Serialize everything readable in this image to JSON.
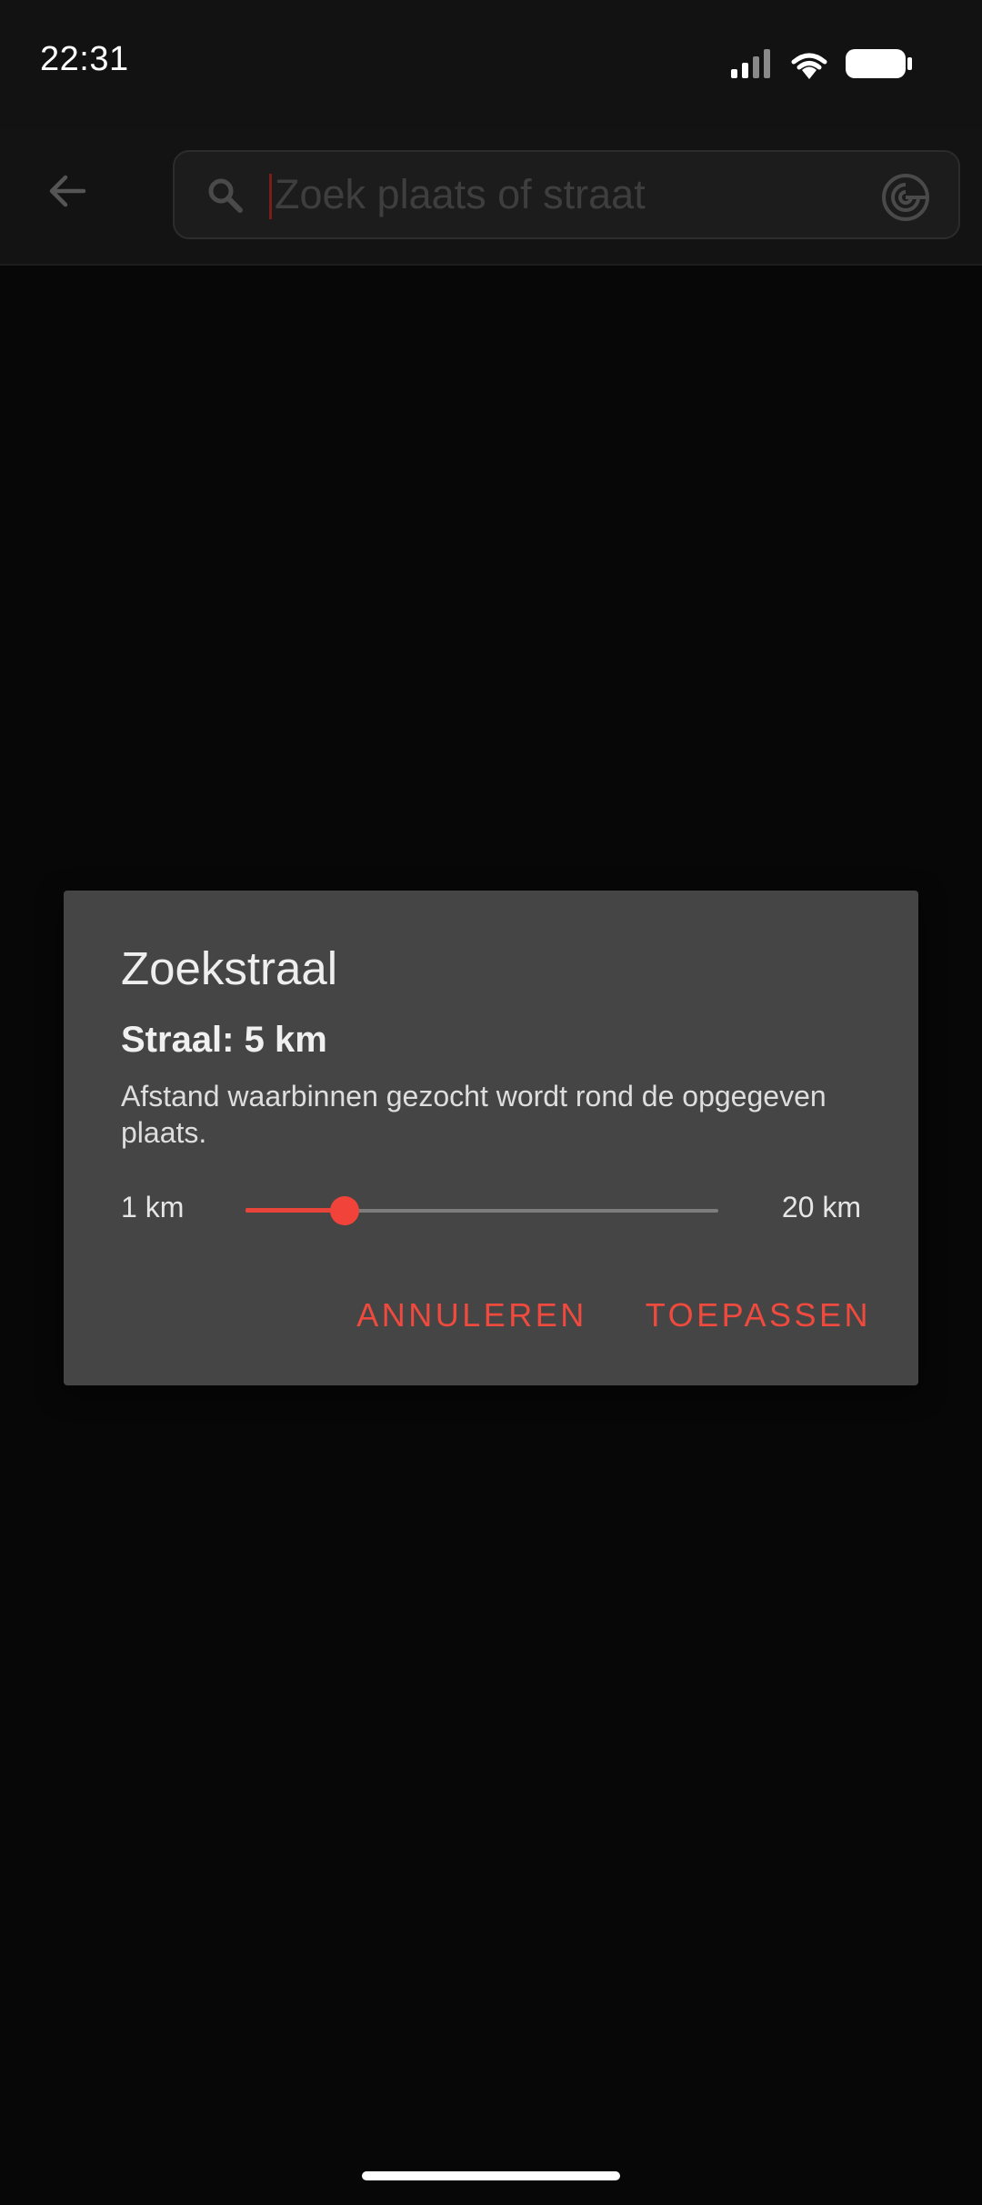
{
  "status_bar": {
    "time": "22:31",
    "icons": [
      "signal-icon",
      "wifi-icon",
      "battery-icon"
    ]
  },
  "app_bar": {
    "back_icon": "arrow-left-icon",
    "search": {
      "value": "",
      "placeholder": "Zoek plaats of straat",
      "search_icon": "search-icon",
      "radius_icon": "radar-icon"
    }
  },
  "dialog": {
    "title": "Zoekstraal",
    "radius_label": "Straal: 5 km",
    "description": "Afstand waarbinnen gezocht wordt rond de opgegeven plaats.",
    "slider": {
      "min_label": "1 km",
      "max_label": "20 km",
      "min": 1,
      "max": 20,
      "value": 5
    },
    "actions": {
      "cancel": "ANNULEREN",
      "apply": "TOEPASSEN"
    }
  },
  "colors": {
    "accent": "#ef4a3e",
    "dialog_bg": "#454545",
    "scrim_bg": "#070707"
  }
}
